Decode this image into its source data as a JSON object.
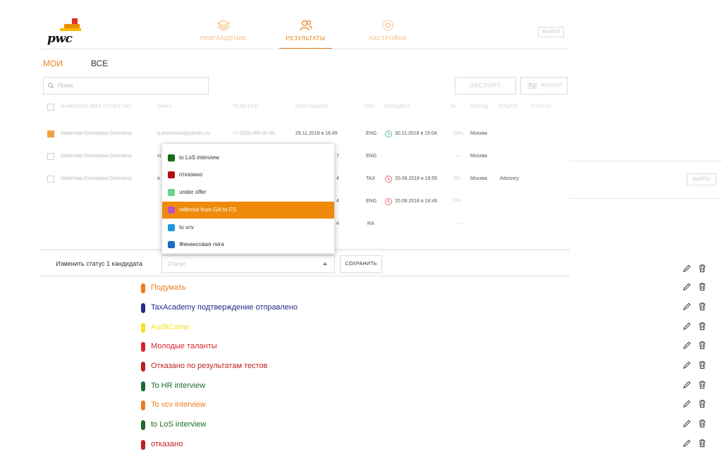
{
  "logo_text": "pwc",
  "nav": [
    {
      "label": "ПРИГЛАШЕНИЕ",
      "icon": "layers-icon"
    },
    {
      "label": "РЕЗУЛЬТАТЫ",
      "icon": "people-icon"
    },
    {
      "label": "НАСТРОЙКИ",
      "icon": "gear-icon"
    }
  ],
  "logout": "ВЫЙТИ",
  "subtabs": {
    "mine": "МОИ",
    "all": "ВСЕ"
  },
  "search_placeholder": "Поиск",
  "export_label": "ЭКСПОРТ",
  "filter_label": "ФИЛЬТР",
  "columns": [
    "ФАМИЛИЯ ИМЯ ОТЧЕСТВО",
    "EMAIL",
    "ТЕЛЕФОН",
    "ПРИГЛАШЕН ↓",
    "ТИП",
    "ПРОЙДЕН",
    "%",
    "ГОРОД",
    "ОТДЕЛ",
    "СТАТУС"
  ],
  "rows": [
    {
      "name": "Ахметова Екатерина Олеговна",
      "email": "a.ahmetova@yandex.ru",
      "phone": "+7 (925) 000 00 00",
      "invited": "29.11.2018 в 16:49",
      "type": "ENG",
      "passed": "30.11.2018 в 15:04",
      "percent": "20%",
      "city": "Москва",
      "dept": "",
      "checked": true
    },
    {
      "name": "Ахметова Екатерина Олеговна",
      "email": "vi",
      "phone": "",
      "invited": "7",
      "type": "ENG",
      "passed": "",
      "percent": "—",
      "city": "Москва",
      "dept": "",
      "checked": false
    },
    {
      "name": "Ахметова Екатерина Олеговна",
      "email": "e",
      "phone": "",
      "invited": "4",
      "type": "TAX",
      "passed": "20.08.2018 в 18:55",
      "percent": "0%",
      "city": "Москва",
      "dept": "Advisory",
      "checked": false
    },
    {
      "name": "",
      "email": "",
      "phone": "",
      "invited": "4",
      "type": "ENG",
      "passed": "20.08.2018 в 18:46",
      "percent": "0%",
      "city": "",
      "dept": "",
      "checked": false
    },
    {
      "name": "",
      "email": "",
      "phone": "",
      "invited": "4",
      "type": "RA",
      "passed": "",
      "percent": "—",
      "city": "",
      "dept": "",
      "checked": false
    }
  ],
  "dropdown_options": [
    {
      "label": "to LoS interview",
      "color": "#1a6b1a"
    },
    {
      "label": "отказано",
      "color": "#b01010"
    },
    {
      "label": "under offer",
      "color": "#6fd28a"
    },
    {
      "label": "referred from GA to FS",
      "color": "#c04fc0",
      "selected": true
    },
    {
      "label": "to vcv",
      "color": "#1a9ad8"
    },
    {
      "label": "Финансовая лига",
      "color": "#1e6fc0"
    }
  ],
  "bar": {
    "label": "Изменить статус 1 кандидата",
    "status_placeholder": "Статус",
    "save": "СОХРАНИТЬ"
  },
  "statuses": [
    {
      "label": "Подумать",
      "color": "#f07b1a"
    },
    {
      "label": "TaxAcademy подтверждение отправлено",
      "color": "#2a2a8a"
    },
    {
      "label": "AuditCamp",
      "color": "#f5e22a"
    },
    {
      "label": "Молодые таланты",
      "color": "#d8242a"
    },
    {
      "label": "Отказано по результатам тестов",
      "color": "#c01f1f"
    },
    {
      "label": "To HR interview",
      "color": "#1b6b2b"
    },
    {
      "label": "To vcv interview",
      "color": "#f07b1a"
    },
    {
      "label": "to LoS interview",
      "color": "#1b6b2b"
    },
    {
      "label": "отказано",
      "color": "#c01f1f"
    }
  ]
}
